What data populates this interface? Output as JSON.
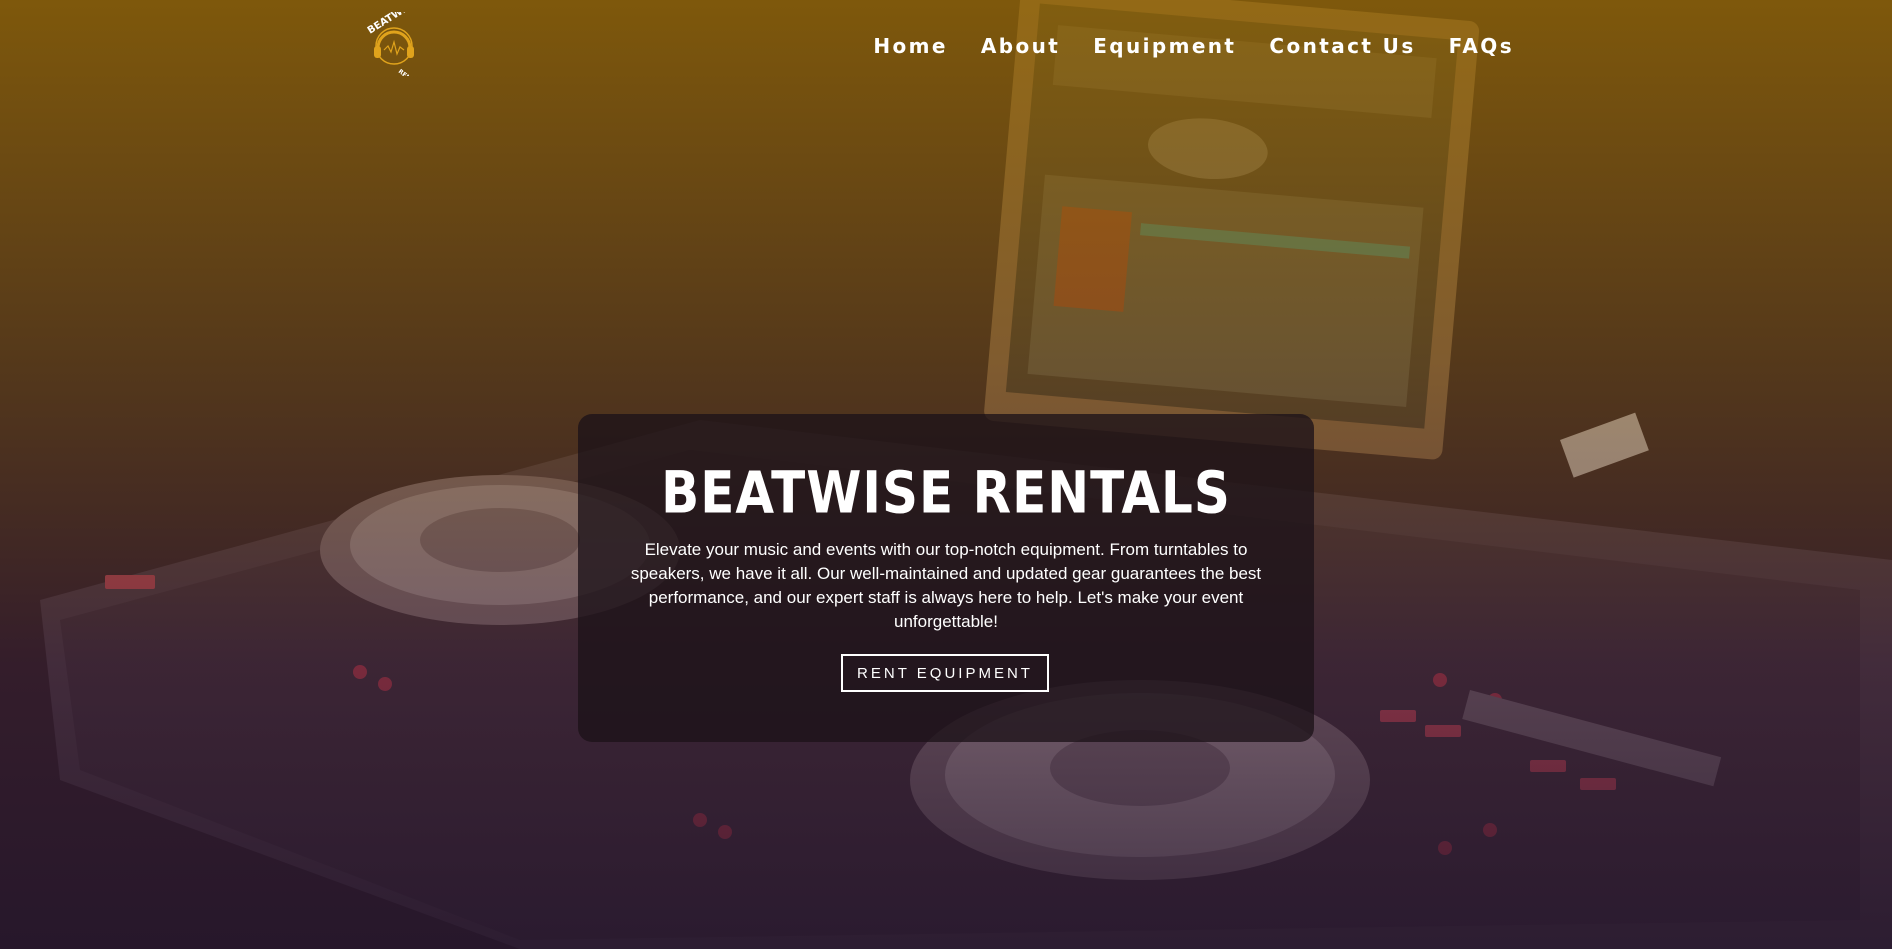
{
  "brand": {
    "logo_arc_text": "BEATWISE",
    "logo_sub_text": "RENTALS",
    "accent_color": "#e0a31c"
  },
  "nav": {
    "items": [
      {
        "label": "Home"
      },
      {
        "label": "About"
      },
      {
        "label": "Equipment"
      },
      {
        "label": "Contact Us"
      },
      {
        "label": "FAQs"
      }
    ]
  },
  "hero": {
    "title": "BEATWISE RENTALS",
    "description": "Elevate your music and events with our top-notch equipment. From turntables to speakers, we have it all. Our well-maintained and updated gear guarantees the best performance, and our expert staff is always here to help. Let's make your event unforgettable!",
    "cta_label": "RENT EQUIPMENT",
    "background_image": "dj-controller-photo",
    "overlay_colors": [
      "#966905",
      "#26162d"
    ]
  }
}
